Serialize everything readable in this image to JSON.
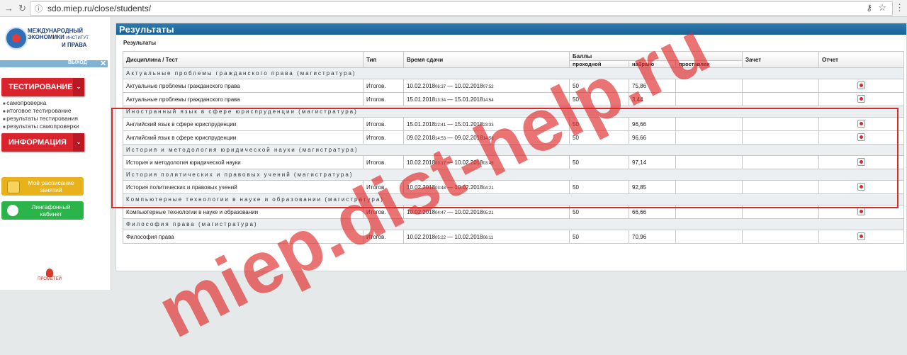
{
  "browser": {
    "url": "sdo.miep.ru/close/students/"
  },
  "sidebar": {
    "logo": {
      "line1": "МЕЖДУНАРОДНЫЙ",
      "line2": "ЭКОНОМИКИ",
      "line2b": "ИНСТИТУТ",
      "line3": "И ПРАВА"
    },
    "exit_label": "ВЫХОД",
    "menu1": {
      "label": "ТЕСТИРОВАНИЕ",
      "links": [
        "самопроверка",
        "итоговое тестирование",
        "результаты тестирования",
        "результаты самопроверки"
      ]
    },
    "menu2": {
      "label": "ИНФОРМАЦИЯ"
    },
    "schedule_button": {
      "label": "Моё расписание занятий",
      "color": "#e8b21b"
    },
    "lingaphone_button": {
      "label": "Лингафонный кабинет",
      "color": "#2bb44a"
    },
    "footer_logo": "ПРОМЕТЕЙ"
  },
  "main": {
    "title": "Результаты",
    "subtitle": "Результаты",
    "headers": {
      "discipline": "Дисциплина / Тест",
      "type": "Тип",
      "time": "Время сдачи",
      "points": "Баллы",
      "passing": "проходной",
      "scored": "набрано",
      "missed": "проставлен",
      "credit": "Зачет",
      "report": "Отчет"
    },
    "groups": [
      {
        "name": "Актуальные проблемы гражданского права (магистратура)",
        "rows": [
          {
            "name": "Актуальные проблемы гражданского права",
            "type": "Итогов.",
            "d1": "10.02.2018",
            "t1": "06:37",
            "d2": "10.02.2018",
            "t2": "07:52",
            "pass": "50",
            "score": "75,86"
          },
          {
            "name": "Актуальные проблемы гражданского права",
            "type": "Итогов.",
            "d1": "15.01.2018",
            "t1": "13:34",
            "d2": "15.01.2018",
            "t2": "14:54",
            "pass": "50",
            "score": "3,44"
          }
        ]
      },
      {
        "name": "Иностранный язык в сфере юриспруденции (магистратура)",
        "rows": [
          {
            "name": "Английский язык в сфере юриспруденции",
            "type": "Итогов.",
            "d1": "15.01.2018",
            "t1": "22:41",
            "d2": "15.01.2018",
            "t2": "23:33",
            "pass": "50",
            "score": "96,66"
          },
          {
            "name": "Английский язык в сфере юриспруденции",
            "type": "Итогов.",
            "d1": "09.02.2018",
            "t1": "14:53",
            "d2": "09.02.2018",
            "t2": "14:58",
            "pass": "50",
            "score": "96,66"
          }
        ]
      },
      {
        "name": "История и методология юридической науки (магистратура)",
        "rows": [
          {
            "name": "История и методология юридической науки",
            "type": "Итогов.",
            "d1": "10.02.2018",
            "t1": "03:17",
            "d2": "10.02.2018",
            "t2": "03:45",
            "pass": "50",
            "score": "97,14"
          }
        ]
      },
      {
        "name": "История политических и правовых учений (магистратура)",
        "rows": [
          {
            "name": "История политических и правовых учений",
            "type": "Итогов.",
            "d1": "10.02.2018",
            "t1": "03:48",
            "d2": "10.02.2018",
            "t2": "04:21",
            "pass": "50",
            "score": "92,85"
          }
        ]
      },
      {
        "name": "Компьютерные технологии в науке и образовании (магистратура)",
        "rows": [
          {
            "name": "Компьютерные технологии в науке и образовании",
            "type": "Итогов.",
            "d1": "10.02.2018",
            "t1": "04:47",
            "d2": "10.02.2018",
            "t2": "05:21",
            "pass": "50",
            "score": "66,66"
          }
        ]
      },
      {
        "name": "Философия права (магистратура)",
        "rows": [
          {
            "name": "Философия права",
            "type": "Итогов.",
            "d1": "10.02.2018",
            "t1": "05:22",
            "d2": "10.02.2018",
            "t2": "06:11",
            "pass": "50",
            "score": "70,96"
          }
        ]
      }
    ]
  },
  "watermark": "miep.dist-help.ru",
  "colors": {
    "accent": "#1b6196",
    "menu_red": "#d9232d",
    "highlight": "#d92a2a"
  }
}
